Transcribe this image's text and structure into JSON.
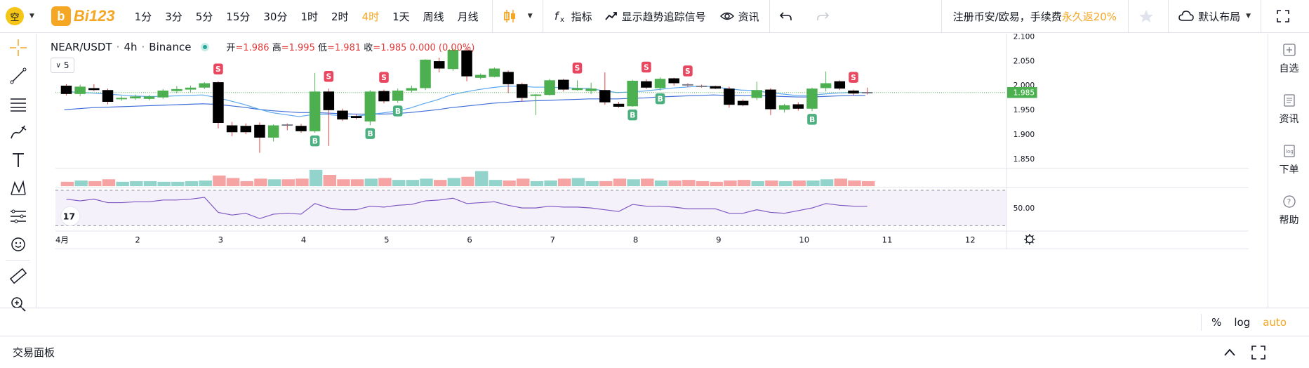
{
  "topbar": {
    "mode_label": "空",
    "logo_text": "Bi123",
    "intervals": [
      "1分",
      "3分",
      "5分",
      "15分",
      "30分",
      "1时",
      "2时",
      "4时",
      "1天",
      "周线",
      "月线"
    ],
    "active_interval": "4时",
    "indicators_label": "指标",
    "trend_signal_label": "显示趋势追踪信号",
    "news_label": "资讯",
    "promo_text": "注册币安/欧易，手续费",
    "promo_highlight": "永久返20%",
    "layout_label": "默认布局"
  },
  "legend": {
    "symbol": "NEAR/USDT",
    "interval": "4h",
    "exchange": "Binance",
    "open_label": "开",
    "open": "1.986",
    "high_label": "高",
    "high": "1.995",
    "low_label": "低",
    "low": "1.981",
    "close_label": "收",
    "close": "1.985",
    "change": "0.000 (0.00%)",
    "collapse_count": "5"
  },
  "price_axis": {
    "ticks": [
      "2.100",
      "2.050",
      "2.000",
      "1.950",
      "1.900",
      "1.850"
    ],
    "current_price": "1.985",
    "rsi_tick": "50.00"
  },
  "time_axis": {
    "ticks": [
      "4月",
      "2",
      "3",
      "4",
      "5",
      "6",
      "7",
      "8",
      "9",
      "10",
      "11",
      "12"
    ]
  },
  "scale_buttons": {
    "percent": "%",
    "log": "log",
    "auto": "auto"
  },
  "right_panel": {
    "items": [
      "自选",
      "资讯",
      "下单",
      "帮助"
    ]
  },
  "footer": {
    "title": "交易面板"
  },
  "colors": {
    "up": "#4caf50",
    "down": "#000000",
    "neutral": "#787b86",
    "accent": "#f5a623",
    "vol_up": "#92d4cc",
    "vol_down": "#f5a3a3",
    "rsi": "#7e57c2"
  },
  "chart_data": {
    "type": "candlestick",
    "ylim": [
      1.83,
      2.105
    ],
    "candles": [
      [
        1.999,
        1.982,
        2.002,
        1.979
      ],
      [
        1.982,
        1.997,
        2.001,
        1.978
      ],
      [
        1.994,
        1.99,
        2.002,
        1.988
      ],
      [
        1.99,
        1.966,
        1.993,
        1.961
      ],
      [
        1.972,
        1.974,
        1.978,
        1.968
      ],
      [
        1.973,
        1.977,
        1.981,
        1.97
      ],
      [
        1.972,
        1.977,
        1.98,
        1.969
      ],
      [
        1.975,
        1.989,
        1.992,
        1.972
      ],
      [
        1.988,
        1.992,
        1.998,
        1.984
      ],
      [
        1.991,
        1.995,
        1.999,
        1.986
      ],
      [
        1.995,
        2.004,
        2.006,
        1.992
      ],
      [
        2.006,
        1.923,
        2.008,
        1.912
      ],
      [
        1.918,
        1.904,
        1.925,
        1.896
      ],
      [
        1.917,
        1.904,
        1.922,
        1.9
      ],
      [
        1.919,
        1.893,
        1.924,
        1.862
      ],
      [
        1.893,
        1.918,
        1.92,
        1.885
      ],
      [
        1.92,
        1.918,
        1.922,
        1.908
      ],
      [
        1.917,
        1.906,
        1.921,
        1.903
      ],
      [
        1.906,
        1.987,
        2.025,
        1.903
      ],
      [
        1.987,
        1.949,
        1.993,
        1.876
      ],
      [
        1.948,
        1.93,
        1.952,
        1.927
      ],
      [
        1.937,
        1.933,
        1.941,
        1.93
      ],
      [
        1.926,
        1.987,
        1.99,
        1.918
      ],
      [
        1.988,
        1.967,
        1.991,
        1.963
      ],
      [
        1.968,
        1.989,
        1.993,
        1.964
      ],
      [
        1.989,
        1.994,
        1.999,
        1.985
      ],
      [
        1.994,
        2.052,
        2.053,
        1.99
      ],
      [
        2.049,
        2.034,
        2.056,
        2.026
      ],
      [
        2.033,
        2.072,
        2.075,
        2.029
      ],
      [
        2.071,
        2.018,
        2.075,
        2.008
      ],
      [
        2.015,
        2.021,
        2.024,
        2.012
      ],
      [
        2.017,
        2.034,
        2.036,
        2.016
      ],
      [
        2.027,
        2.002,
        2.03,
        1.984
      ],
      [
        2.002,
        1.974,
        2.005,
        1.966
      ],
      [
        1.978,
        1.981,
        1.982,
        1.939
      ],
      [
        1.98,
        2.01,
        2.013,
        1.979
      ],
      [
        2.011,
        1.991,
        2.013,
        1.987
      ],
      [
        1.99,
        1.994,
        2.01,
        1.989
      ],
      [
        1.988,
        1.993,
        2.005,
        1.982
      ],
      [
        1.99,
        1.965,
        2.026,
        1.96
      ],
      [
        1.962,
        1.956,
        1.966,
        1.954
      ],
      [
        1.957,
        2.009,
        2.011,
        1.956
      ],
      [
        2.008,
        1.995,
        2.012,
        1.992
      ],
      [
        1.994,
        2.013,
        2.016,
        1.989
      ],
      [
        2.014,
        2.004,
        2.015,
        1.999
      ],
      [
        2.002,
        2.0,
        2.004,
        1.996
      ],
      [
        1.999,
        1.997,
        2.001,
        1.995
      ],
      [
        1.998,
        1.993,
        1.999,
        1.992
      ],
      [
        1.993,
        1.96,
        1.997,
        1.954
      ],
      [
        1.968,
        1.959,
        1.971,
        1.957
      ],
      [
        1.974,
        1.99,
        2.007,
        1.97
      ],
      [
        1.991,
        1.951,
        1.994,
        1.939
      ],
      [
        1.95,
        1.959,
        1.962,
        1.944
      ],
      [
        1.961,
        1.952,
        1.965,
        1.948
      ],
      [
        1.952,
        1.993,
        1.995,
        1.947
      ],
      [
        1.994,
        2.004,
        2.028,
        1.987
      ],
      [
        2.008,
        1.993,
        2.01,
        1.99
      ],
      [
        1.989,
        1.983,
        1.991,
        1.979
      ],
      [
        1.986,
        1.985,
        1.995,
        1.981
      ]
    ],
    "signals": [
      {
        "index": 11,
        "type": "S"
      },
      {
        "index": 19,
        "type": "S"
      },
      {
        "index": 23,
        "type": "S"
      },
      {
        "index": 37,
        "type": "S"
      },
      {
        "index": 42,
        "type": "S"
      },
      {
        "index": 45,
        "type": "S"
      },
      {
        "index": 57,
        "type": "S"
      },
      {
        "index": 18,
        "type": "B"
      },
      {
        "index": 22,
        "type": "B"
      },
      {
        "index": 24,
        "type": "B"
      },
      {
        "index": 41,
        "type": "B"
      },
      {
        "index": 43,
        "type": "B"
      },
      {
        "index": 54,
        "type": "B"
      }
    ],
    "ma_short": [
      1.988,
      1.985,
      1.984,
      1.982,
      1.98,
      1.978,
      1.977,
      1.977,
      1.978,
      1.979,
      1.98,
      1.975,
      1.968,
      1.961,
      1.952,
      1.944,
      1.94,
      1.936,
      1.94,
      1.94,
      1.938,
      1.936,
      1.94,
      1.943,
      1.947,
      1.953,
      1.962,
      1.97,
      1.98,
      1.986,
      1.991,
      1.995,
      1.998,
      1.998,
      1.996,
      1.996,
      1.995,
      1.994,
      1.993,
      1.989,
      1.985,
      1.986,
      1.988,
      1.991,
      1.994,
      1.996,
      1.998,
      1.997,
      1.993,
      1.99,
      1.989,
      1.985,
      1.982,
      1.979,
      1.979,
      1.982,
      1.984,
      1.985,
      1.985
    ],
    "ma_long": [
      1.95,
      1.952,
      1.954,
      1.955,
      1.956,
      1.957,
      1.958,
      1.959,
      1.96,
      1.961,
      1.962,
      1.961,
      1.958,
      1.955,
      1.951,
      1.948,
      1.946,
      1.944,
      1.944,
      1.943,
      1.942,
      1.941,
      1.941,
      1.941,
      1.942,
      1.944,
      1.947,
      1.95,
      1.954,
      1.957,
      1.96,
      1.963,
      1.965,
      1.967,
      1.968,
      1.969,
      1.97,
      1.971,
      1.972,
      1.972,
      1.972,
      1.973,
      1.974,
      1.976,
      1.977,
      1.978,
      1.979,
      1.98,
      1.979,
      1.979,
      1.979,
      1.978,
      1.977,
      1.976,
      1.976,
      1.977,
      1.978,
      1.979,
      1.979
    ],
    "volume": [
      7,
      9,
      8,
      11,
      7,
      8,
      8,
      7,
      7,
      8,
      9,
      17,
      13,
      8,
      12,
      11,
      11,
      12,
      26,
      18,
      11,
      11,
      12,
      13,
      10,
      10,
      12,
      10,
      13,
      15,
      24,
      10,
      9,
      12,
      8,
      9,
      12,
      13,
      8,
      8,
      12,
      11,
      12,
      9,
      9,
      10,
      8,
      7,
      9,
      10,
      8,
      9,
      8,
      9,
      9,
      11,
      12,
      9,
      8
    ],
    "rsi": [
      60,
      58,
      60,
      56,
      56,
      57,
      57,
      59,
      59,
      60,
      62,
      45,
      42,
      44,
      38,
      43,
      44,
      43,
      55,
      50,
      48,
      48,
      52,
      51,
      53,
      54,
      58,
      59,
      61,
      55,
      56,
      57,
      53,
      50,
      50,
      52,
      51,
      51,
      50,
      48,
      46,
      54,
      52,
      52,
      51,
      49,
      49,
      49,
      44,
      44,
      48,
      45,
      44,
      47,
      50,
      55,
      53,
      52,
      52
    ]
  }
}
